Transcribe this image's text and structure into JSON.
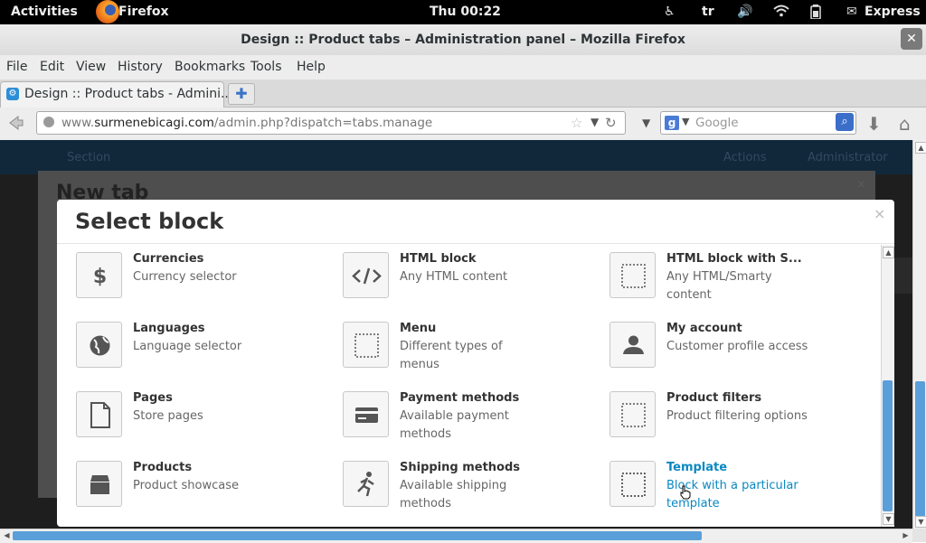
{
  "gnome": {
    "activities": "Activities",
    "app_name": "Firefox",
    "clock": "Thu 00:22",
    "keyboard_layout": "tr",
    "user": "Express"
  },
  "window": {
    "title": "Design :: Product tabs – Administration panel – Mozilla Firefox",
    "close_glyph": "✕"
  },
  "menubar": [
    "File",
    "Edit",
    "View",
    "History",
    "Bookmarks",
    "Tools",
    "Help"
  ],
  "tab": {
    "title": "Design :: Product tabs - Admini...",
    "new_tab_glyph": "✚"
  },
  "navbar": {
    "url_prefix": "www.",
    "url_domain": "surmenebicagi.com",
    "url_path": "/admin.php?dispatch=tabs.manage",
    "search_placeholder": "Google"
  },
  "background": {
    "nav_left": "Section",
    "nav_actions": "Actions",
    "nav_user": "Administrator",
    "modal_title": "New tab"
  },
  "modal": {
    "title": "Select block",
    "close_glyph": "×",
    "blocks": [
      {
        "name": "Currencies",
        "desc": "Currency selector",
        "icon": "dollar-icon"
      },
      {
        "name": "HTML block",
        "desc": "Any HTML content",
        "icon": "code-icon"
      },
      {
        "name": "HTML block with S...",
        "desc": "Any HTML/Smarty content",
        "icon": "dotted-square-icon"
      },
      {
        "name": "Languages",
        "desc": "Language selector",
        "icon": "globe-icon"
      },
      {
        "name": "Menu",
        "desc": "Different types of menus",
        "icon": "dotted-square-icon"
      },
      {
        "name": "My account",
        "desc": "Customer profile access",
        "icon": "user-icon"
      },
      {
        "name": "Pages",
        "desc": "Store pages",
        "icon": "page-icon"
      },
      {
        "name": "Payment methods",
        "desc": "Available payment methods",
        "icon": "credit-card-icon"
      },
      {
        "name": "Product filters",
        "desc": "Product filtering options",
        "icon": "dotted-square-icon"
      },
      {
        "name": "Products",
        "desc": "Product showcase",
        "icon": "box-icon"
      },
      {
        "name": "Shipping methods",
        "desc": "Available shipping methods",
        "icon": "runner-icon"
      },
      {
        "name": "Template",
        "desc": "Block with a particular template",
        "icon": "dotted-square-icon"
      }
    ]
  },
  "colors": {
    "link_blue": "#0a88c2",
    "scroll_blue": "#5a9fd9",
    "admin_nav": "#11283a"
  }
}
